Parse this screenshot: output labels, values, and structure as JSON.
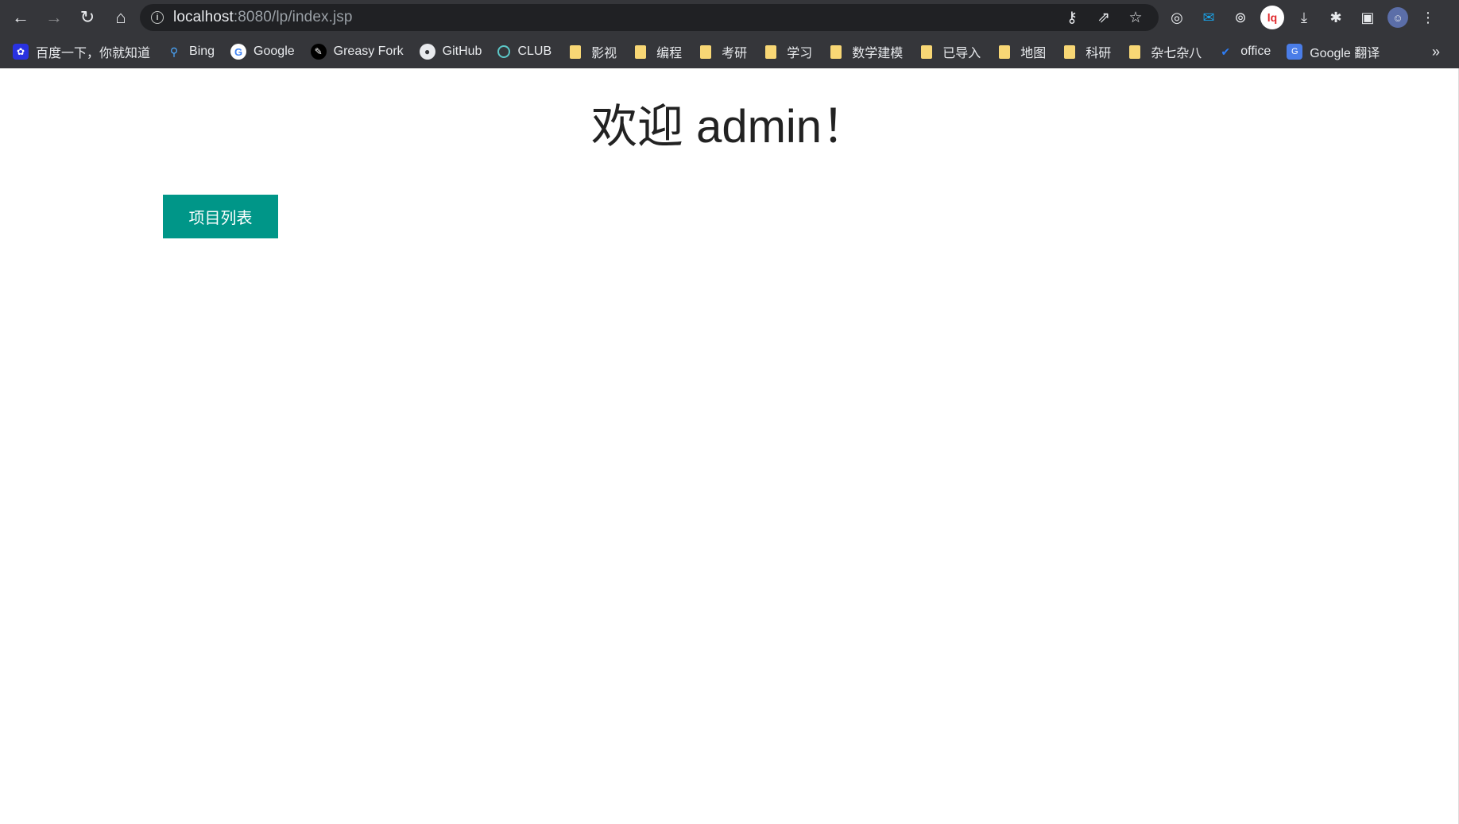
{
  "browser": {
    "url_host": "localhost",
    "url_rest": ":8080/lp/index.jsp",
    "nav": {
      "back": "←",
      "forward": "→",
      "reload": "↻",
      "home": "⌂"
    },
    "omnibox_icons": {
      "info": "i",
      "key": "⚷",
      "share": "⇗",
      "star": "☆"
    },
    "extensions": {
      "ext1": "◎",
      "ext2": "✉",
      "ext3": "⊚",
      "ext4": "lq",
      "download": "⤓",
      "puzzle": "✱",
      "sidepanel": "▣",
      "avatar": "☺",
      "menu": "⋮"
    }
  },
  "bookmarks": {
    "items": [
      {
        "label": "百度一下，你就知道",
        "icon": "baidu-icon",
        "glyph": "✿"
      },
      {
        "label": "Bing",
        "icon": "bing-icon",
        "glyph": "⚲"
      },
      {
        "label": "Google",
        "icon": "google-icon",
        "glyph": "G"
      },
      {
        "label": "Greasy Fork",
        "icon": "greasy-fork-icon",
        "glyph": "✎"
      },
      {
        "label": "GitHub",
        "icon": "github-icon",
        "glyph": "●"
      },
      {
        "label": "CLUB",
        "icon": "club-icon",
        "glyph": ""
      },
      {
        "label": "影视",
        "icon": "folder-icon",
        "glyph": ""
      },
      {
        "label": "编程",
        "icon": "folder-icon",
        "glyph": ""
      },
      {
        "label": "考研",
        "icon": "folder-icon",
        "glyph": ""
      },
      {
        "label": "学习",
        "icon": "folder-icon",
        "glyph": ""
      },
      {
        "label": "数学建模",
        "icon": "folder-icon",
        "glyph": ""
      },
      {
        "label": "已导入",
        "icon": "folder-icon",
        "glyph": ""
      },
      {
        "label": "地图",
        "icon": "folder-icon",
        "glyph": ""
      },
      {
        "label": "科研",
        "icon": "folder-icon",
        "glyph": ""
      },
      {
        "label": "杂七杂八",
        "icon": "folder-icon",
        "glyph": ""
      },
      {
        "label": "office",
        "icon": "office-icon",
        "glyph": "✔"
      },
      {
        "label": "Google 翻译",
        "icon": "google-translate-icon",
        "glyph": "G"
      }
    ],
    "more": "»"
  },
  "page": {
    "heading": "欢迎 admin！",
    "project_list_button": "项目列表"
  },
  "colors": {
    "chrome_bg": "#35363a",
    "omnibox_bg": "#202124",
    "button_bg": "#009688",
    "folder": "#f8d775"
  }
}
